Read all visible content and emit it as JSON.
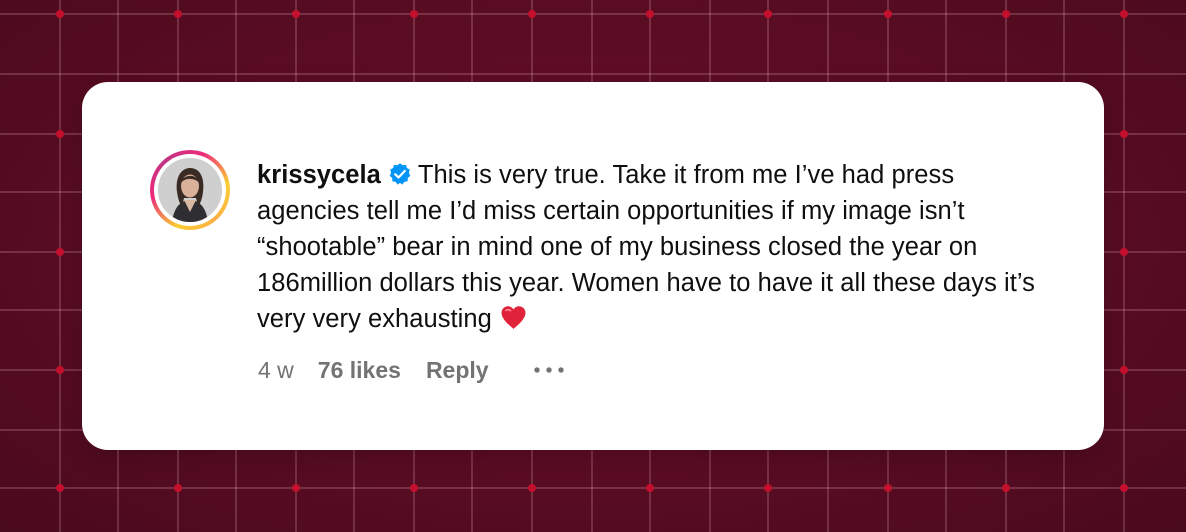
{
  "comment": {
    "username": "krissycela",
    "verified_icon": "verified-badge-icon",
    "text": "This is very true. Take it from me I’ve had press agencies tell me I’d miss certain opportunities if my image isn’t “shootable” bear in mind one of my business closed the year on 186million dollars this year. Women have to have it all these days it’s very very exhausting",
    "emoji_icon": "red-heart-icon"
  },
  "meta": {
    "time": "4 w",
    "likes": "76 likes",
    "reply_label": "Reply",
    "more_icon": "ellipsis-icon"
  },
  "colors": {
    "background": "#5a0c22",
    "card": "#ffffff",
    "text": "#0f0f0f",
    "meta_text": "#737373",
    "verified": "#0095f6",
    "heart": "#e0233a"
  }
}
